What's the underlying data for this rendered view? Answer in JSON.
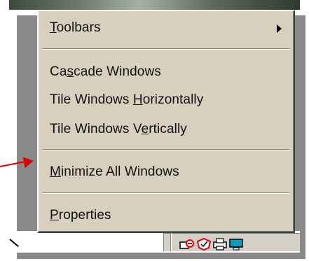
{
  "context_menu": {
    "items": [
      {
        "label": "Toolbars",
        "accel": "T",
        "rest": "oolbars",
        "has_submenu": true
      },
      {
        "label": "Cascade Windows",
        "pre": "Ca",
        "accel": "s",
        "rest": "cade Windows"
      },
      {
        "label": "Tile Windows Horizontally",
        "pre": "Tile Windows ",
        "accel": "H",
        "rest": "orizontally"
      },
      {
        "label": "Tile Windows Vertically",
        "pre": "Tile Windows V",
        "accel": "e",
        "rest": "rtically"
      },
      {
        "label": "Minimize All Windows",
        "accel": "M",
        "rest": "inimize All Windows"
      },
      {
        "label": "Properties",
        "accel": "P",
        "rest": "roperties"
      }
    ]
  },
  "colors": {
    "menu_bg": "#d7d0bf",
    "callout_arrow": "#e00000",
    "tray_bg": "#d4d0c8"
  },
  "icons": {
    "submenu": "triangle-right-icon",
    "callout": "red-arrow-icon",
    "tray": [
      "network-icon",
      "antivirus-icon",
      "printer-icon",
      "display-icon"
    ]
  }
}
